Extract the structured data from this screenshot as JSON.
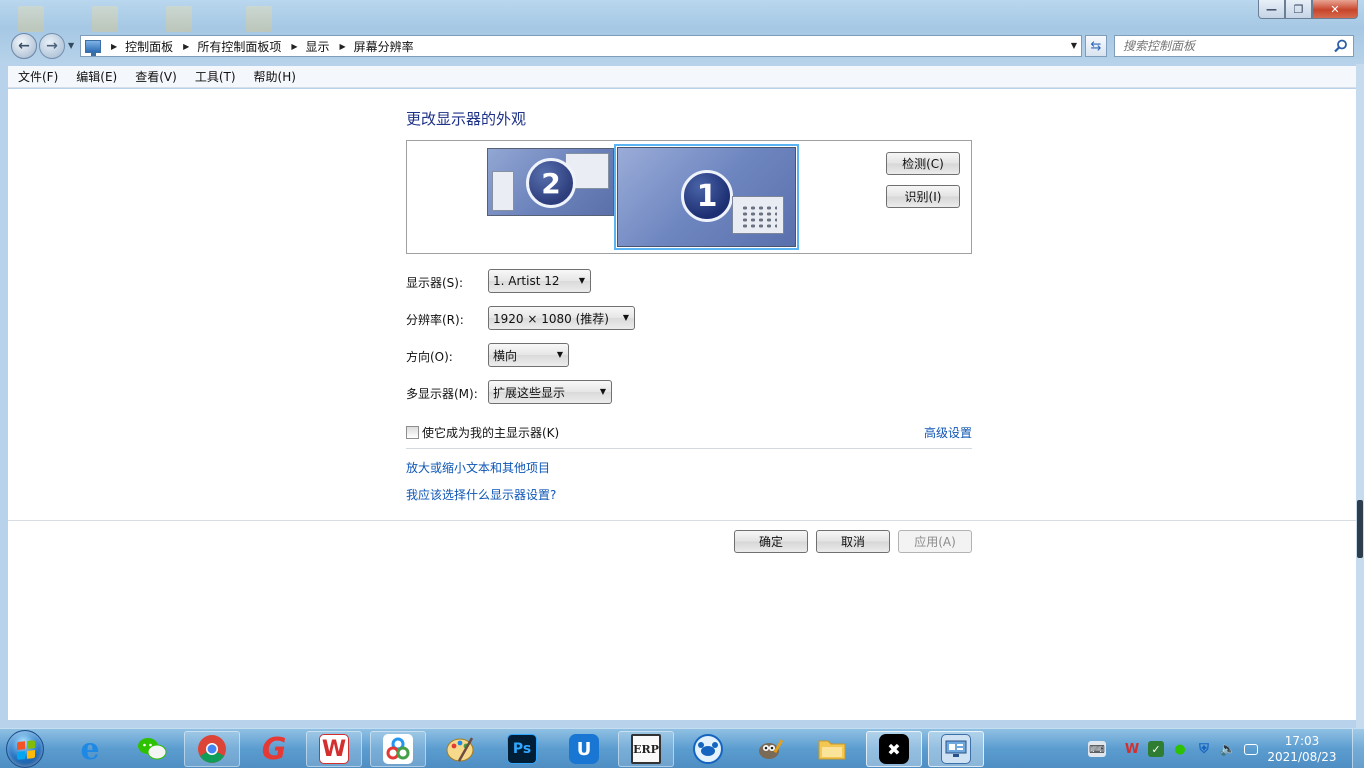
{
  "address": {
    "crumbs": [
      "控制面板",
      "所有控制面板项",
      "显示",
      "屏幕分辨率"
    ]
  },
  "search": {
    "placeholder": "搜索控制面板"
  },
  "menu": [
    "文件(F)",
    "编辑(E)",
    "查看(V)",
    "工具(T)",
    "帮助(H)"
  ],
  "main": {
    "heading": "更改显示器的外观",
    "monitors": [
      {
        "number": "2",
        "primary": false
      },
      {
        "number": "1",
        "primary": true
      }
    ],
    "detect_label": "检测(C)",
    "identify_label": "识别(I)",
    "display_label": "显示器(S):",
    "display_value": "1. Artist 12",
    "resolution_label": "分辨率(R):",
    "resolution_value": "1920 × 1080 (推荐)",
    "orientation_label": "方向(O):",
    "orientation_value": "横向",
    "multi_label": "多显示器(M):",
    "multi_value": "扩展这些显示",
    "primary_checkbox_label": "使它成为我的主显示器(K)",
    "primary_checked": false,
    "advanced_link": "高级设置",
    "link_text_size": "放大或缩小文本和其他项目",
    "link_which_settings": "我应该选择什么显示器设置?"
  },
  "footer": {
    "ok_label": "确定",
    "cancel_label": "取消",
    "apply_label": "应用(A)"
  },
  "taskbar": {
    "apps": [
      {
        "name": "internet-explorer",
        "color": "#1e88e5"
      },
      {
        "name": "wechat",
        "color": "#2dc100"
      },
      {
        "name": "chrome",
        "color": "#db4437"
      },
      {
        "name": "app-g",
        "color": "#e53935"
      },
      {
        "name": "wps-office",
        "color": "#d32f2f"
      },
      {
        "name": "baidu-netdisk",
        "color": "#2196f3"
      },
      {
        "name": "paint",
        "color": "#ffb300"
      },
      {
        "name": "photoshop",
        "color": "#001e36",
        "glyph": "Ps"
      },
      {
        "name": "app-u",
        "color": "#1976d2"
      },
      {
        "name": "erp",
        "color": "#333333",
        "glyph": "ERP"
      },
      {
        "name": "crab-app",
        "color": "#90caf9"
      },
      {
        "name": "gimp",
        "color": "#795548"
      },
      {
        "name": "file-explorer",
        "color": "#f9c74f"
      },
      {
        "name": "capcut",
        "color": "#000000"
      },
      {
        "name": "control-panel",
        "color": "#6fa8dc"
      }
    ],
    "time": "17:03",
    "date": "2021/08/23"
  }
}
